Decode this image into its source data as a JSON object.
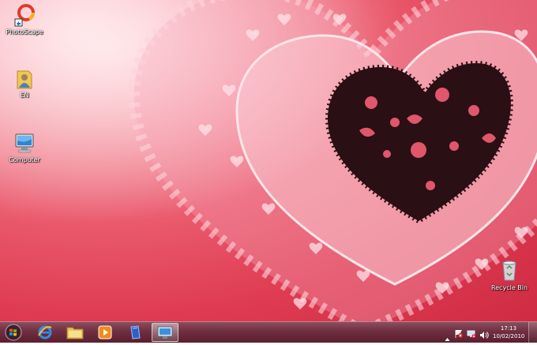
{
  "desktop": {
    "icons": [
      {
        "label": "PhotoScape",
        "icon": "photoscape-icon"
      },
      {
        "label": "EN",
        "icon": "user-folder-icon"
      },
      {
        "label": "Computer",
        "icon": "computer-icon"
      },
      {
        "label": "Recycle Bin",
        "icon": "recycle-bin-icon"
      }
    ]
  },
  "taskbar": {
    "pinned": [
      {
        "name": "start-button",
        "icon": "windows-orb-icon"
      },
      {
        "name": "internet-explorer",
        "icon": "internet-explorer-icon"
      },
      {
        "name": "windows-explorer",
        "icon": "folder-icon"
      },
      {
        "name": "media-player",
        "icon": "media-player-icon"
      },
      {
        "name": "app-blue",
        "icon": "book-icon"
      },
      {
        "name": "control-panel",
        "icon": "monitor-icon",
        "active": true
      }
    ],
    "tray": {
      "time": "17:13",
      "date": "10/02/2010",
      "icons": [
        "show-hidden-icon",
        "action-center-icon",
        "network-icon",
        "volume-icon"
      ]
    }
  },
  "colors": {
    "wallpaper_base": "#de3b52",
    "heart_dark": "#2a0f14",
    "taskbar": "#6f2f40"
  }
}
